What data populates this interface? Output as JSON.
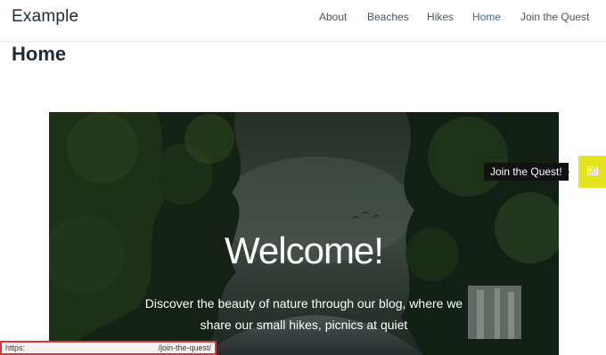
{
  "header": {
    "site_title": "Example",
    "nav": [
      {
        "label": "About"
      },
      {
        "label": "Beaches"
      },
      {
        "label": "Hikes"
      },
      {
        "label": "Home",
        "active": true
      },
      {
        "label": "Join the Quest"
      }
    ]
  },
  "page": {
    "title": "Home"
  },
  "hero": {
    "heading": "Welcome!",
    "text": "Discover the beauty of nature through our blog, where we share our small hikes, picnics at quiet"
  },
  "floating_widget": {
    "tooltip": "Join the Quest!",
    "icon": "contact-card-icon",
    "button_color": "#e6e21e"
  },
  "status_bar": {
    "url_scheme": "https:",
    "url_path": "/join-the-quest/"
  },
  "colors": {
    "nav_active": "#3d6c9a",
    "title_text": "#1e2b3a",
    "status_highlight": "#d43a3a"
  }
}
